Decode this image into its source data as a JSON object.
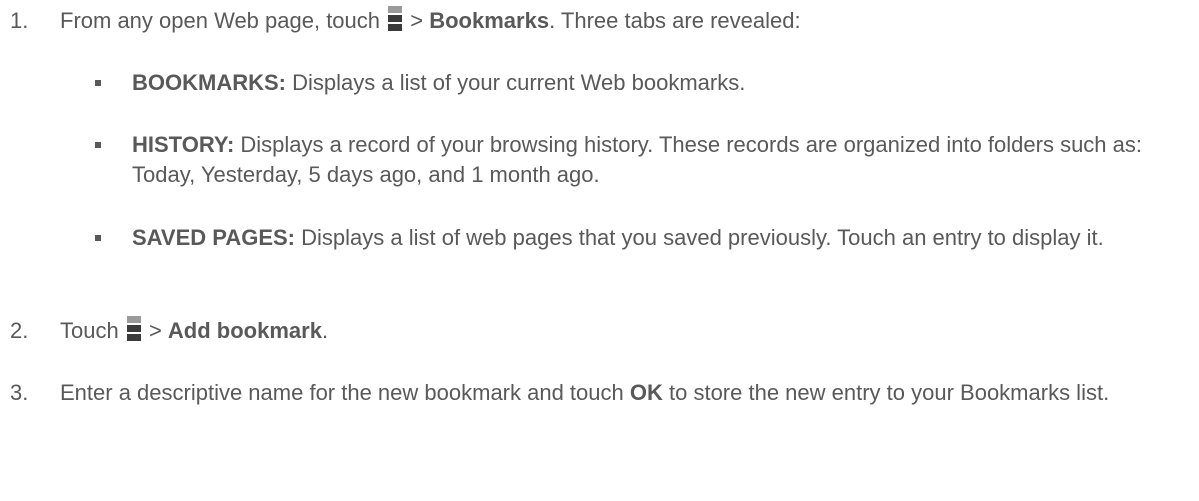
{
  "steps": [
    {
      "number": "1.",
      "text_before": "From any open Web page, touch",
      "icon": "menu-icon",
      "separator": " > ",
      "bold": "Bookmarks",
      "text_after": ". Three tabs are revealed:",
      "subitems": [
        {
          "term": "BOOKMARKS:",
          "description": "Displays a list of your current Web bookmarks."
        },
        {
          "term": "HISTORY:",
          "description": "Displays a record of your browsing history. These records are organized into folders such as: Today, Yesterday, 5 days ago, and 1 month ago."
        },
        {
          "term": "SAVED PAGES:",
          "description": "Displays a list of web pages that you saved previously. Touch an entry to display it."
        }
      ]
    },
    {
      "number": "2.",
      "text_before": "Touch",
      "icon": "menu-icon",
      "separator": " > ",
      "bold": "Add bookmark",
      "text_after": "."
    },
    {
      "number": "3.",
      "text_before": "Enter a descriptive name for the new bookmark and touch",
      "bold": "OK",
      "text_after": "to store the new entry to your Bookmarks list."
    }
  ],
  "colors": {
    "text": "#595959",
    "icon_light": "#9a9a9a",
    "icon_dark": "#3a3a3a"
  }
}
